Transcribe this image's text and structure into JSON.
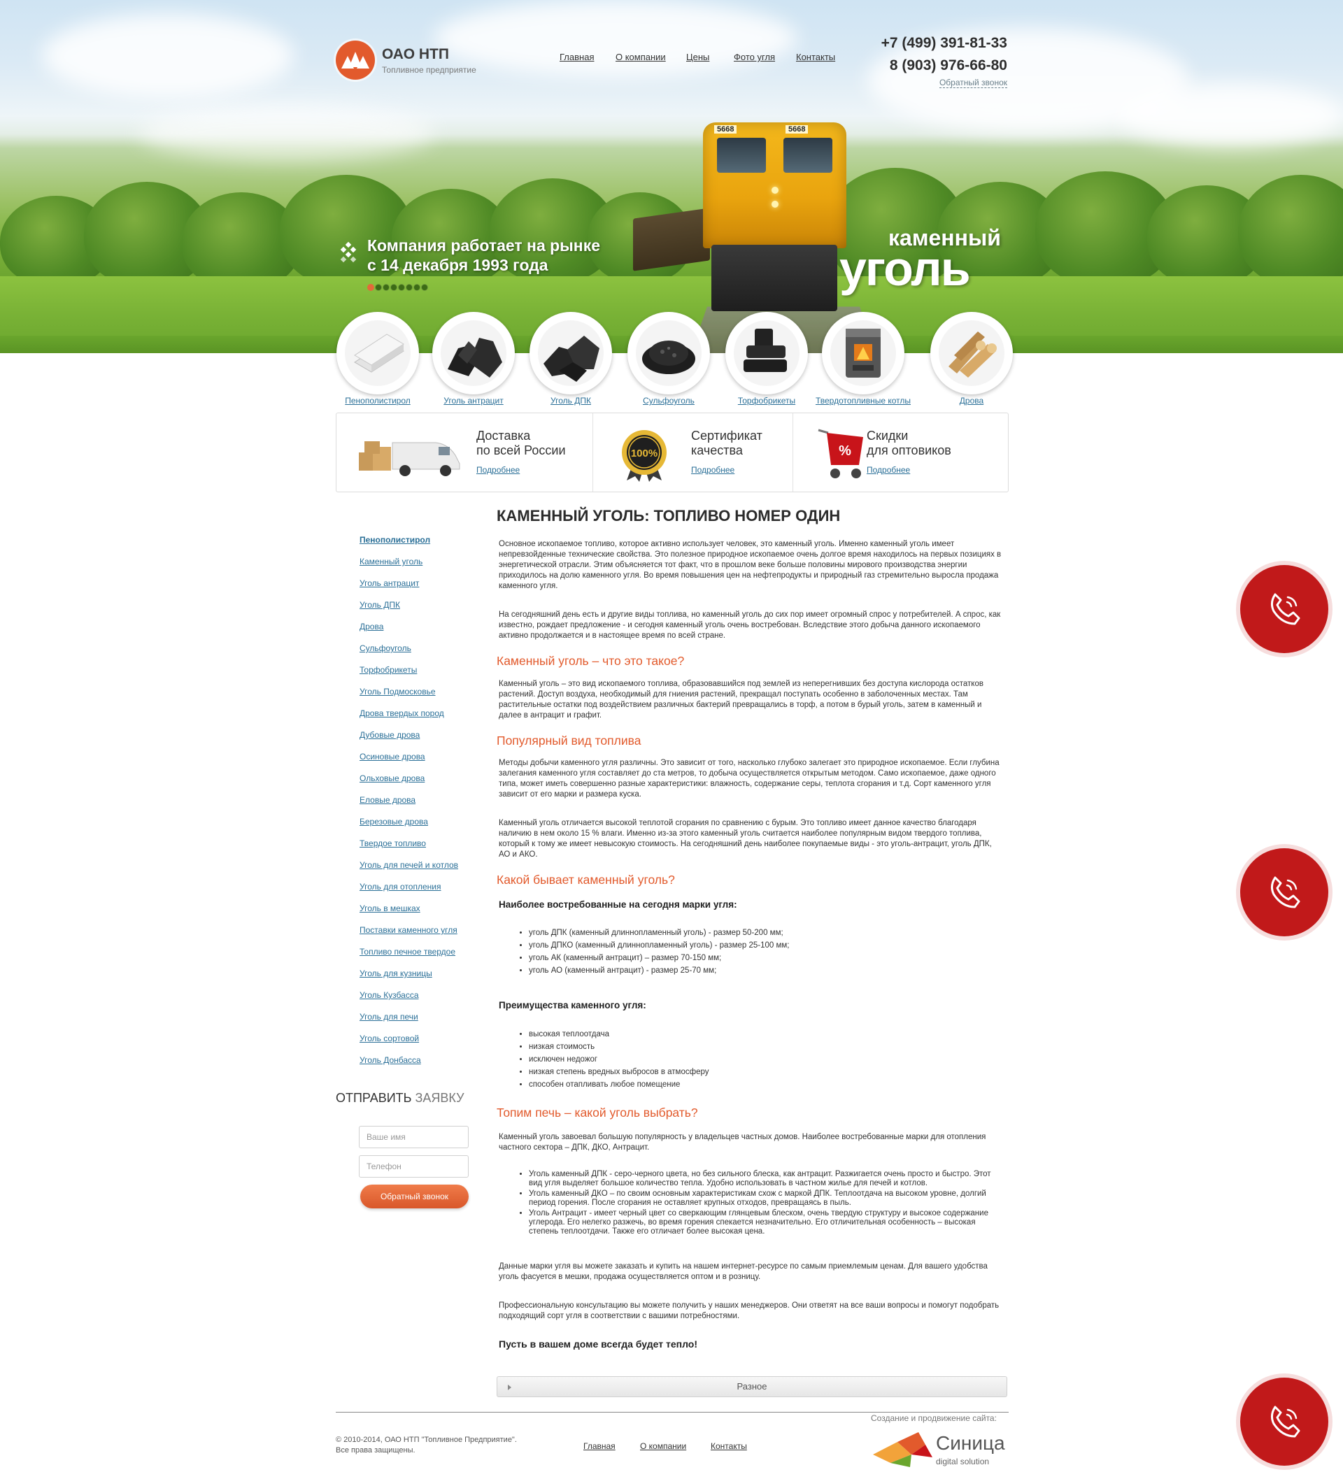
{
  "header": {
    "logo_title": "ОАО НТП",
    "logo_subtitle": "Топливное предприятие",
    "nav": [
      "Главная",
      "О компании",
      "Цены",
      "Фото угля",
      "Контакты"
    ],
    "phones": [
      "+7 (499) 391-81-33",
      "8 (903) 976-66-80"
    ],
    "callback_link": "Обратный звонок"
  },
  "hero": {
    "slogan_line1": "Компания работает на рынке",
    "slogan_line2": "с 14 декабря 1993 года",
    "title_small": "каменный",
    "title_big": "уголь",
    "slide_count": 8,
    "active_slide": 1,
    "train_number": "5668"
  },
  "products": [
    {
      "label": "Пенополистирол",
      "icon": "foam-sheets-icon"
    },
    {
      "label": "Уголь антрацит",
      "icon": "coal-chunks-icon"
    },
    {
      "label": "Уголь ДПК",
      "icon": "coal-lumps-icon"
    },
    {
      "label": "Сульфоуголь",
      "icon": "coal-granules-icon"
    },
    {
      "label": "Торфобрикеты",
      "icon": "peat-briquettes-icon"
    },
    {
      "label": "Твердотопливные котлы",
      "icon": "boiler-stove-icon"
    },
    {
      "label": "Дрова",
      "icon": "firewood-icon"
    }
  ],
  "features": [
    {
      "line1": "Доставка",
      "line2": "по всей России",
      "link": "Подробнее",
      "icon": "delivery-van-icon"
    },
    {
      "line1": "Сертификат",
      "line2": "качества",
      "link": "Подробнее",
      "icon": "quality-seal-icon",
      "seal_text": "100%"
    },
    {
      "line1": "Скидки",
      "line2": "для оптовиков",
      "link": "Подробнее",
      "icon": "discount-cart-icon",
      "cart_text": "%"
    }
  ],
  "sidebar": {
    "items": [
      "Пенополистирол",
      "Каменный уголь",
      "Уголь антрацит",
      "Уголь ДПК",
      "Дрова",
      "Сульфоуголь",
      "Торфобрикеты",
      "Уголь Подмосковье",
      "Дрова твердых пород",
      "Дубовые дрова",
      "Осиновые дрова",
      "Ольховые дрова",
      "Еловые дрова",
      "Березовые дрова",
      "Твердое топливо",
      "Уголь для печей и котлов",
      "Уголь для отопления",
      "Уголь в мешках",
      "Поставки каменного угля",
      "Топливо печное твердое",
      "Уголь для кузницы",
      "Уголь Кузбасса",
      "Уголь для печи",
      "Уголь сортовой",
      "Уголь Донбасса"
    ],
    "order_title_a": "ОТПРАВИТЬ",
    "order_title_b": "ЗАЯВКУ",
    "name_placeholder": "Ваше имя",
    "phone_placeholder": "Телефон",
    "submit_label": "Обратный звонок"
  },
  "content": {
    "h1": "КАМЕННЫЙ УГОЛЬ: ТОПЛИВО НОМЕР ОДИН",
    "p1": "Основное ископаемое топливо, которое активно использует человек, это каменный уголь. Именно каменный уголь имеет непревзойденные технические свойства. Это полезное природное ископаемое очень долгое время находилось на первых позициях в энергетической отрасли. Этим объясняется тот факт, что в прошлом веке больше половины мирового производства энергии приходилось на долю каменного угля. Во время повышения цен на нефтепродукты и природный газ стремительно выросла продажа каменного угля.",
    "p2": "На сегодняшний день есть и другие виды топлива, но каменный уголь до сих пор имеет огромный спрос у потребителей. А спрос, как известно, рождает предложение - и сегодня каменный уголь очень востребован. Вследствие этого добыча данного ископаемого активно продолжается и в настоящее время по всей стране.",
    "h2_1": "Каменный уголь – что это такое?",
    "p3": "Каменный уголь – это вид ископаемого топлива, образовавшийся под землей из неперегнивших без доступа кислорода остатков растений. Доступ воздуха, необходимый для гниения растений, прекращал поступать особенно в заболоченных местах. Там растительные остатки под воздействием различных бактерий превращались в торф, а потом в бурый уголь, затем в каменный и далее в антрацит и графит.",
    "h2_2": "Популярный вид топлива",
    "p4": "Методы добычи каменного угля различны. Это зависит от того, насколько глубоко залегает это природное ископаемое. Если глубина залегания каменного угля составляет до ста метров, то добыча осуществляется открытым методом. Само ископаемое, даже одного типа, может иметь совершенно разные характеристики: влажность, содержание серы, теплота сгорания и т.д. Сорт каменного угля зависит от его марки и размера куска.",
    "p5": "Каменный уголь отличается высокой теплотой сгорания по сравнению с бурым. Это топливо имеет данное качество благодаря наличию в нем около 15 % влаги. Именно из-за этого каменный уголь считается наиболее популярным видом твердого топлива, который к тому же имеет невысокую стоимость. На сегодняшний день наиболее покупаемые виды - это уголь-антрацит, уголь ДПК, АО и АКО.",
    "h2_3": "Какой бывает каменный уголь?",
    "b1": "Наиболее востребованные на сегодня марки угля:",
    "list1": [
      "уголь ДПК (каменный длиннопламенный уголь) - размер 50-200 мм;",
      "уголь ДПКО (каменный длиннопламенный уголь) - размер 25-100 мм;",
      "уголь АК (каменный антрацит) – размер 70-150 мм;",
      "уголь АО (каменный антрацит) - размер 25-70 мм;"
    ],
    "b2": "Преимущества каменного угля:",
    "list2": [
      "высокая теплоотдача",
      "низкая стоимость",
      "исключен недожог",
      "низкая степень вредных выбросов в атмосферу",
      "способен отапливать любое помещение"
    ],
    "h2_4": "Топим печь – какой уголь выбрать?",
    "p6": "Каменный уголь завоевал большую популярность у владельцев частных домов. Наиболее востребованные марки для отопления частного сектора – ДПК, ДКО, Антрацит.",
    "list3": [
      "Уголь каменный ДПК - серо-черного цвета, но без сильного блеска, как антрацит. Разжигается очень просто и быстро. Этот вид угля выделяет большое количество тепла. Удобно использовать в частном жилье для печей и котлов.",
      "Уголь каменный ДКО – по своим основным характеристикам схож с маркой ДПК. Теплоотдача на высоком уровне, долгий период горения. После сгорания не оставляет крупных отходов, превращаясь в пыль.",
      "Уголь Антрацит - имеет черный цвет со сверкающим глянцевым блеском, очень твердую структуру и высокое содержание углерода. Его нелегко разжечь, во время горения спекается незначительно. Его отличительная особенность – высокая степень теплоотдачи. Также его отличает более высокая цена."
    ],
    "p7": "Данные марки угля вы можете заказать и купить на нашем интернет-ресурсе по самым приемлемым ценам. Для вашего удобства уголь фасуется в мешки, продажа осуществляется оптом и в розницу.",
    "p8": "Профессиональную консультацию вы можете получить у наших менеджеров. Они ответят на все ваши вопросы и помогут подобрать подходящий сорт угля в соответствии с вашими потребностями.",
    "final": "Пусть в вашем доме всегда будет тепло!",
    "misc_label": "Разное"
  },
  "footer": {
    "copyright_line1": "© 2010-2014, ОАО НТП \"Топливное Предприятие\".",
    "copyright_line2": "Все права защищены.",
    "nav": [
      "Главная",
      "О компании",
      "Контакты"
    ],
    "credit": "Создание и продвижение сайта:",
    "studio_name": "Синица",
    "studio_sub": "digital solution"
  },
  "floating": {
    "call_buttons": 3,
    "icon": "phone-call-icon"
  },
  "colors": {
    "accent": "#e25a2c",
    "link": "#2a6f97",
    "call_button": "#c1191a"
  }
}
